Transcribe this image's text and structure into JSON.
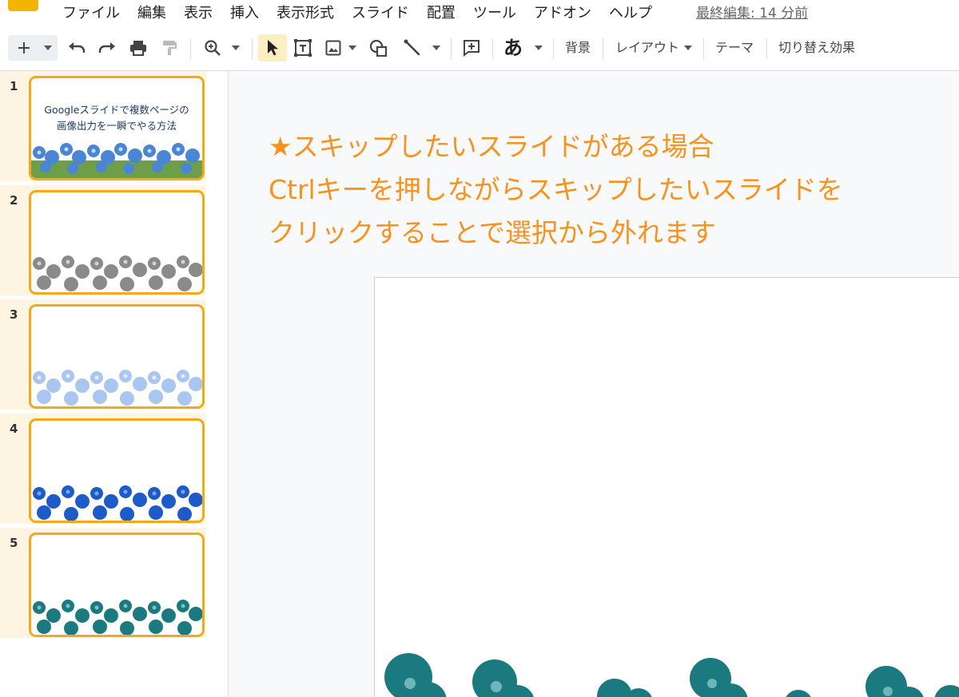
{
  "app": {
    "logo_icon": "slides-logo-icon",
    "brand_color": "#f4b400"
  },
  "menu": {
    "items": [
      "ファイル",
      "編集",
      "表示",
      "挿入",
      "表示形式",
      "スライド",
      "配置",
      "ツール",
      "アドオン",
      "ヘルプ"
    ],
    "last_edit": "最終編集: 14 分前"
  },
  "toolbar": {
    "text_style": "あ",
    "background": "背景",
    "layout": "レイアウト",
    "theme": "テーマ",
    "transition": "切り替え効果",
    "icons": [
      "plus-icon",
      "undo-icon",
      "redo-icon",
      "print-icon",
      "paint-format-icon",
      "zoom-icon",
      "select-cursor-icon",
      "textbox-icon",
      "image-icon",
      "shape-icon",
      "line-icon",
      "comment-add-icon"
    ]
  },
  "slides": [
    {
      "num": "1",
      "title_line1": "Googleスライドで複数ページの",
      "title_line2": "画像出力を一瞬でやる方法",
      "flower_color": "#4a86d6"
    },
    {
      "num": "2",
      "flower_color": "#8a8a8a"
    },
    {
      "num": "3",
      "flower_color": "#a8c6f0"
    },
    {
      "num": "4",
      "flower_color": "#1c5bc8"
    },
    {
      "num": "5",
      "flower_color": "#1a7a80"
    }
  ],
  "canvas": {
    "annotation": {
      "line1": "★スキップしたいスライドがある場合",
      "line2": "Ctrlキーを押しながらスキップしたいスライドを",
      "line3": "クリックすることで選択から外れます",
      "color": "#f7921e"
    },
    "selection_color": "#f4a91a"
  }
}
